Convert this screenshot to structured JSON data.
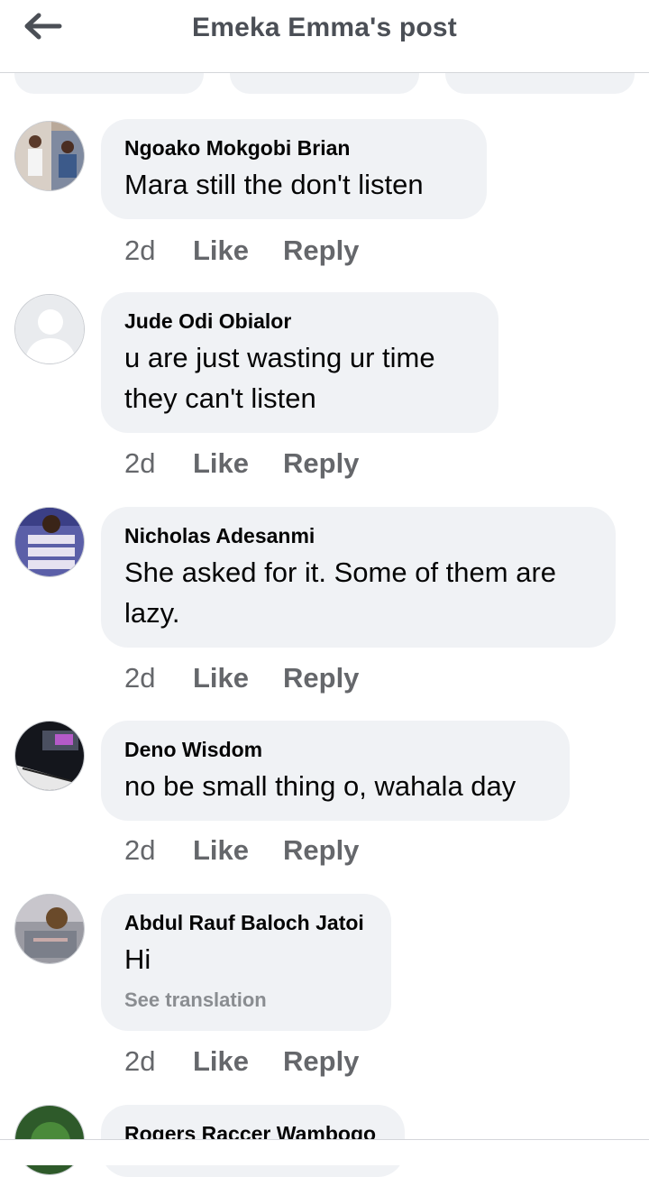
{
  "header": {
    "title": "Emeka Emma's post",
    "back_icon": "arrow-left-icon"
  },
  "colors": {
    "bubble": "#f0f2f5",
    "meta_text": "#65676b",
    "header_text": "#4b4f56"
  },
  "comments": [
    {
      "author": "Ngoako Mokgobi Brian",
      "text": "Mara still the don't listen",
      "time": "2d",
      "like": "Like",
      "reply": "Reply"
    },
    {
      "author": "Jude Odi Obialor",
      "text": "u are just wasting ur time they can't listen",
      "time": "2d",
      "like": "Like",
      "reply": "Reply"
    },
    {
      "author": "Nicholas Adesanmi",
      "text": "She asked for it. Some of them are lazy.",
      "time": "2d",
      "like": "Like",
      "reply": "Reply"
    },
    {
      "author": "Deno Wisdom",
      "text": "no be small thing o, wahala day",
      "time": "2d",
      "like": "Like",
      "reply": "Reply"
    },
    {
      "author": "Abdul Rauf Baloch Jatoi",
      "text": "Hi",
      "translation": "See translation",
      "time": "2d",
      "like": "Like",
      "reply": "Reply"
    },
    {
      "author": "Rogers Raccer Wambogo"
    }
  ]
}
